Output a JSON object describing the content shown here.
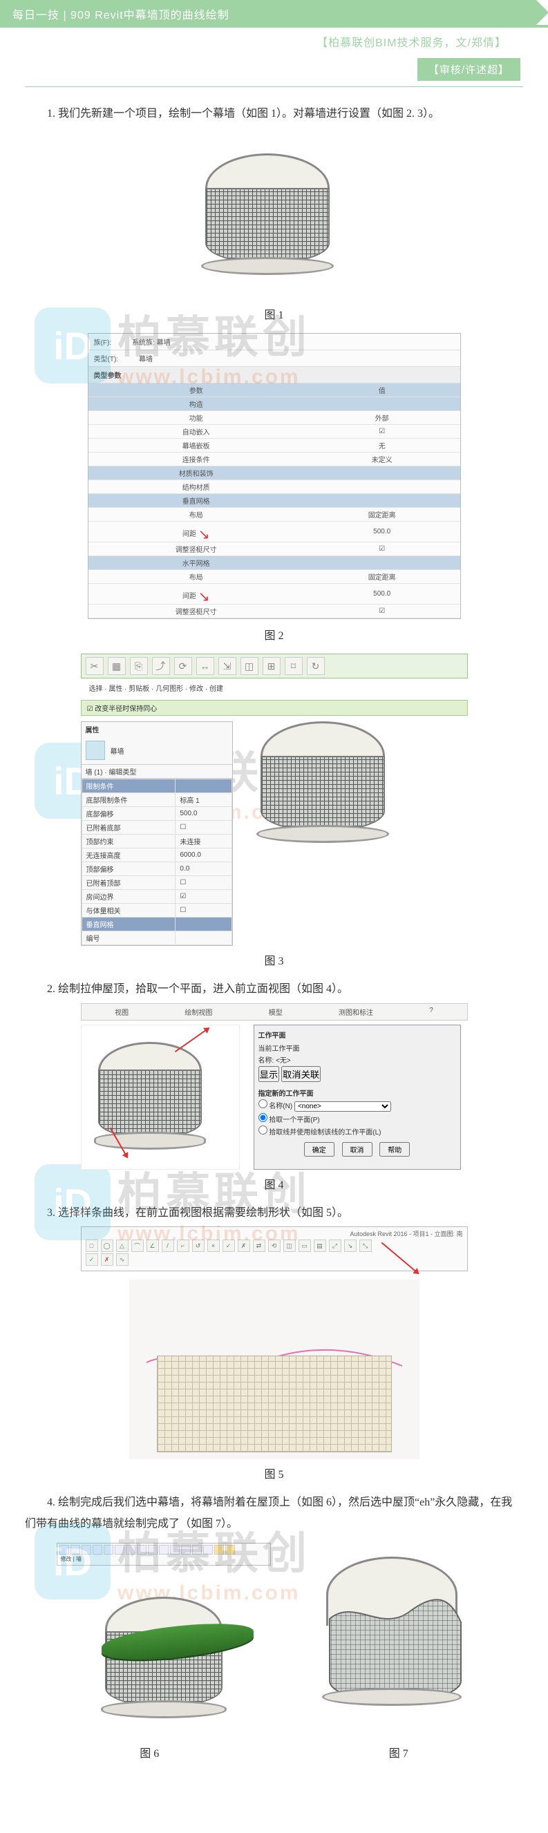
{
  "header": {
    "title": "每日一技 | 909  Revit中幕墙顶的曲线绘制",
    "subtitle": "【柏慕联创BIM技术服务，文/郑倩】",
    "reviewer": "【审核/许述超】"
  },
  "watermark": {
    "logo_letter": "iD",
    "cn": "柏慕联创",
    "en": "www.lcbim.com"
  },
  "paragraphs": {
    "p1": "1. 我们先新建一个项目，绘制一个幕墙（如图 1）。对幕墙进行设置（如图 2. 3）。",
    "p2": "2. 绘制拉伸屋顶，拾取一个平面，进入前立面视图（如图 4）。",
    "p3": "3. 选择样条曲线，在前立面视图根据需要绘制形状（如图 5）。",
    "p4": "4. 绘制完成后我们选中幕墙，将幕墙附着在屋顶上（如图 6），然后选中屋顶“eh”永久隐藏，在我们带有曲线的幕墙就绘制完成了（如图 7）。"
  },
  "captions": {
    "c1": "图 1",
    "c2": "图 2",
    "c3": "图 3",
    "c4": "图 4",
    "c5": "图 5",
    "c6": "图 6",
    "c7": "图 7"
  },
  "fig2": {
    "tab1": "族(F):",
    "tab1v": "系统族: 幕墙",
    "tab2": "类型(T):",
    "tab2v": "幕墙",
    "section": "类型参数",
    "col_param": "参数",
    "col_value": "值",
    "rows": [
      {
        "k": "构造",
        "v": "",
        "hl": true
      },
      {
        "k": "功能",
        "v": "外部"
      },
      {
        "k": "自动嵌入",
        "v": "☑"
      },
      {
        "k": "幕墙嵌板",
        "v": "无"
      },
      {
        "k": "连接条件",
        "v": "未定义"
      },
      {
        "k": "材质和装饰",
        "v": "",
        "hl": true
      },
      {
        "k": "结构材质",
        "v": ""
      },
      {
        "k": "垂直网格",
        "v": "",
        "hl": true
      },
      {
        "k": "布局",
        "v": "固定距离"
      },
      {
        "k": "间距",
        "v": "500.0"
      },
      {
        "k": "调整竖梃尺寸",
        "v": "☑"
      },
      {
        "k": "水平网格",
        "v": "",
        "hl": true
      },
      {
        "k": "布局",
        "v": "固定距离"
      },
      {
        "k": "间距",
        "v": "500.0"
      },
      {
        "k": "调整竖梃尺寸",
        "v": "☑"
      }
    ]
  },
  "fig3": {
    "ribbon_menu": "选择 · 属性 · 剪贴板 · 几何图形 · 修改 · 创建",
    "green_bar": "☑ 改变半径时保持同心",
    "props_title": "属性",
    "type": "幕墙",
    "constraint_dropdown": "墙 (1) · 编辑类型",
    "rows": [
      {
        "k": "限制条件",
        "v": "",
        "hdr": true
      },
      {
        "k": "底部限制条件",
        "v": "标高 1"
      },
      {
        "k": "底部偏移",
        "v": "500.0"
      },
      {
        "k": "已附着底部",
        "v": "☐"
      },
      {
        "k": "顶部约束",
        "v": "未连接"
      },
      {
        "k": "无连接高度",
        "v": "6000.0"
      },
      {
        "k": "顶部偏移",
        "v": "0.0"
      },
      {
        "k": "已附着顶部",
        "v": "☐"
      },
      {
        "k": "房间边界",
        "v": "☑"
      },
      {
        "k": "与体量相关",
        "v": "☐"
      },
      {
        "k": "垂直网格",
        "v": "",
        "hdr": true
      },
      {
        "k": "编号",
        "v": ""
      }
    ]
  },
  "fig4": {
    "ribbon": [
      "视图",
      "绘制视图",
      "模型",
      "测图和标注",
      "?"
    ],
    "dialog_title": "工作平面",
    "current_label": "当前工作平面",
    "name_label": "名称:",
    "name_value": "<无>",
    "btn_show": "显示",
    "btn_dissoc": "取消关联",
    "specify_label": "指定新的工作平面",
    "opt_name": "名称(N)",
    "opt_name_select": "<none>",
    "opt_pick": "拾取一个平面(P)",
    "opt_line": "拾取线并使用绘制该线的工作平面(L)",
    "btn_ok": "确定",
    "btn_cancel": "取消",
    "btn_help": "帮助"
  },
  "fig5": {
    "app_title": "Autodesk Revit 2016 - 项目1 - 立面图: 南",
    "tools": [
      "□",
      "◯",
      "△",
      "⌒",
      "∠",
      "/",
      "⌐",
      "↺",
      "×",
      "✓",
      "✗",
      "⇄",
      "⟲",
      "◫",
      "▭",
      "▤",
      "⤢",
      "↘",
      "⤡"
    ]
  },
  "fig6": {
    "ribbon_label": "修改 | 墙"
  }
}
